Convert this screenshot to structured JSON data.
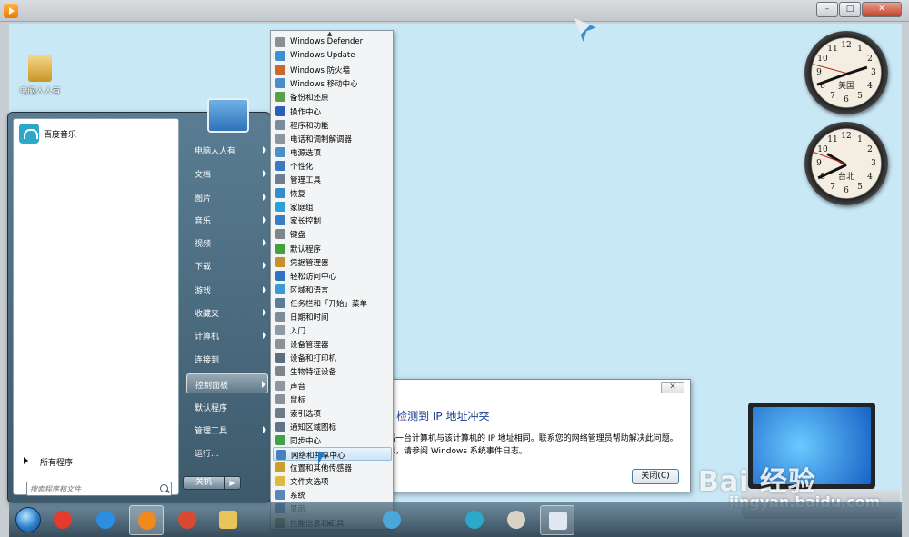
{
  "desktop": {
    "user_icon_label": "电脑人人有"
  },
  "clocks": [
    {
      "city": "美国",
      "numbers": [
        "12",
        "1",
        "2",
        "3",
        "4",
        "5",
        "6",
        "7",
        "8",
        "9",
        "10",
        "11"
      ]
    },
    {
      "city": "台北",
      "numbers": [
        "12",
        "1",
        "2",
        "3",
        "4",
        "5",
        "6",
        "7",
        "8",
        "9",
        "10",
        "11"
      ]
    }
  ],
  "dialog": {
    "close_glyph": "✕",
    "title": "s 检测到 IP 地址冲突",
    "line1": "吕一台计算机与该计算机的 IP 地址相同。联系您的网络管理员帮助解决此问题。",
    "line2": "息，请参阅 Windows 系统事件日志。",
    "button": "关闭(C)"
  },
  "start_menu": {
    "pinned": [
      {
        "label": "百度音乐",
        "icon": "baidu-music-icon"
      }
    ],
    "all_programs": "所有程序",
    "search_placeholder": "搜索程序和文件",
    "right_items": [
      {
        "label": "电脑人人有",
        "arrow": true
      },
      {
        "label": "文档",
        "arrow": true
      },
      {
        "label": "图片",
        "arrow": true
      },
      {
        "label": "音乐",
        "arrow": true
      },
      {
        "label": "视频",
        "arrow": true
      },
      {
        "label": "下载",
        "arrow": true
      },
      {
        "label": "游戏",
        "arrow": true
      },
      {
        "label": "收藏夹",
        "arrow": true
      },
      {
        "label": "计算机",
        "arrow": true
      },
      {
        "label": "连接到",
        "arrow": false
      },
      {
        "label": "控制面板",
        "arrow": true
      },
      {
        "label": "默认程序",
        "arrow": false
      },
      {
        "label": "管理工具",
        "arrow": true
      },
      {
        "label": "运行...",
        "arrow": false
      }
    ],
    "shutdown": "关机",
    "shutdown_arrow": "▶"
  },
  "control_panel_items": [
    {
      "label": "Windows Defender",
      "color": "#8a8f95"
    },
    {
      "label": "Windows Update",
      "color": "#3f8fd6"
    },
    {
      "label": "Windows 防火墙",
      "color": "#c8682a"
    },
    {
      "label": "Windows 移动中心",
      "color": "#4a8fc8"
    },
    {
      "label": "备份和还原",
      "color": "#5aa046"
    },
    {
      "label": "操作中心",
      "color": "#2b5fb8"
    },
    {
      "label": "程序和功能",
      "color": "#7a8c9c"
    },
    {
      "label": "电话和调制解调器",
      "color": "#8c959d"
    },
    {
      "label": "电源选项",
      "color": "#4d8fc9"
    },
    {
      "label": "个性化",
      "color": "#3b7ac0"
    },
    {
      "label": "管理工具",
      "color": "#6f7f8e"
    },
    {
      "label": "恢复",
      "color": "#3a8cc9"
    },
    {
      "label": "家庭组",
      "color": "#2f9fd8"
    },
    {
      "label": "家长控制",
      "color": "#3b7dc4"
    },
    {
      "label": "键盘",
      "color": "#7e868d"
    },
    {
      "label": "默认程序",
      "color": "#46a03e"
    },
    {
      "label": "凭据管理器",
      "color": "#c6912c"
    },
    {
      "label": "轻松访问中心",
      "color": "#2f73c2"
    },
    {
      "label": "区域和语言",
      "color": "#3c9bd2"
    },
    {
      "label": "任务栏和「开始」菜单",
      "color": "#5b7d97"
    },
    {
      "label": "日期和时间",
      "color": "#7c8c99"
    },
    {
      "label": "入门",
      "color": "#8b9aa5"
    },
    {
      "label": "设备管理器",
      "color": "#8a9198"
    },
    {
      "label": "设备和打印机",
      "color": "#5b6f80"
    },
    {
      "label": "生物特征设备",
      "color": "#7d858c"
    },
    {
      "label": "声音",
      "color": "#8f979e"
    },
    {
      "label": "鼠标",
      "color": "#8b9197"
    },
    {
      "label": "索引选项",
      "color": "#6b7b88"
    },
    {
      "label": "通知区域图标",
      "color": "#5f7487"
    },
    {
      "label": "同步中心",
      "color": "#3fa34b"
    },
    {
      "label": "网络和共享中心",
      "color": "#4a7fbe",
      "highlighted": true
    },
    {
      "label": "位置和其他传感器",
      "color": "#c9a12a"
    },
    {
      "label": "文件夹选项",
      "color": "#e0b83c"
    },
    {
      "label": "系统",
      "color": "#5c86b5"
    },
    {
      "label": "显示",
      "color": "#3e6fb0"
    },
    {
      "label": "性能信息和工具",
      "color": "#5f8f3e"
    }
  ],
  "submenu_arrows": {
    "up": "▲",
    "down": "▼"
  },
  "window": {
    "min": "–",
    "max": "□",
    "close": "✕"
  },
  "watermark": {
    "brand": "Bai 经验",
    "url": "jingyan.baidu.com"
  },
  "taskbar": [
    {
      "name": "qq-player-icon",
      "color": "#e43b2c"
    },
    {
      "name": "internet-explorer-icon",
      "color": "#2c8ee0"
    },
    {
      "name": "media-player-icon",
      "color": "#f08a1c"
    },
    {
      "name": "chrome-icon",
      "color": "#d94a33"
    },
    {
      "name": "file-explorer-icon",
      "color": "#e8c45a"
    },
    {
      "name": "pinwheel-app-icon",
      "color": "#4aa8d8"
    },
    {
      "name": "baidu-music-icon",
      "color": "#2ca8c9"
    },
    {
      "name": "paint-icon",
      "color": "#d8d3c6"
    },
    {
      "name": "notepad-icon",
      "color": "#dfe8f2"
    }
  ]
}
